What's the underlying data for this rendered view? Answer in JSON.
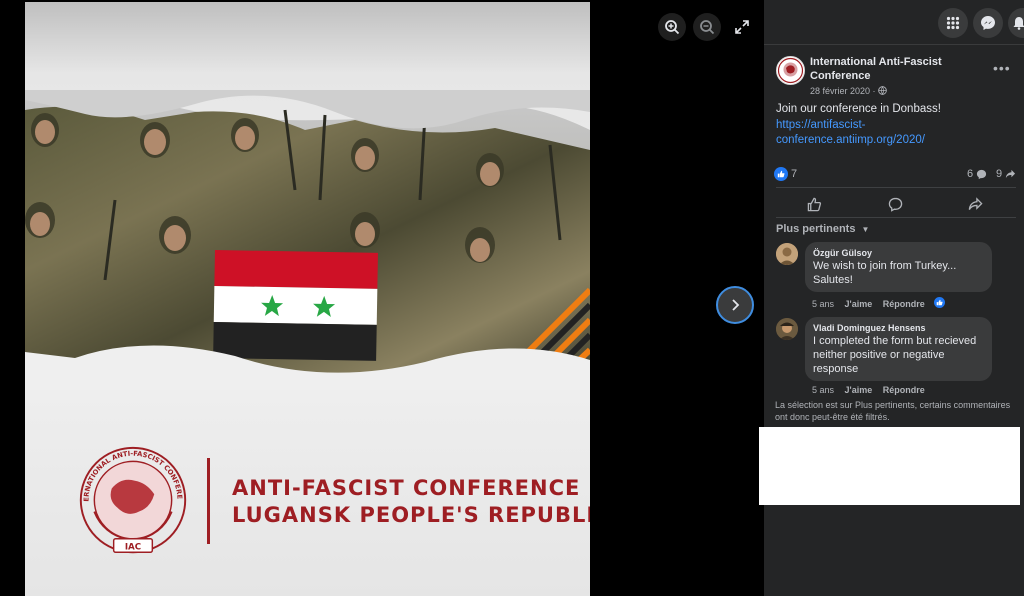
{
  "viewer": {
    "logo": {
      "ring_text": "INTERNATIONAL ANTI-FASCIST CONFERENCE",
      "badge": "IAC",
      "line1": "ANTI-FASCIST CONFERENCE",
      "line2": "LUGANSK PEOPLE'S REPUBLIC"
    }
  },
  "post": {
    "page_name": "International Anti-Fascist Conference",
    "date": "28 février 2020 ·",
    "text": "Join our conference in Donbass!",
    "link": "https://antifascist-conference.antiimp.org/2020/",
    "reactions_count": "7",
    "comments_count": "6",
    "shares_count": "9"
  },
  "comments_sort_label": "Plus pertinents",
  "comments": [
    {
      "author": "Özgür Gülsoy",
      "text": "We wish to join from Turkey... Salutes!",
      "time": "5 ans",
      "like_label": "J'aime",
      "reply_label": "Répondre"
    },
    {
      "author": "Vladi Dominguez Hensens",
      "text": "I completed the form but recieved neither positive or negative response",
      "time": "5 ans",
      "like_label": "J'aime",
      "reply_label": "Répondre"
    }
  ],
  "filter_note": "La sélection est sur Plus pertinents, certains commentaires ont donc peut-être été filtrés.",
  "colors": {
    "accent": "#2078f4",
    "link": "#4599ff",
    "panel_bg": "#242526",
    "bubble_bg": "#3a3b3c",
    "logo_red": "#9e1e23"
  }
}
